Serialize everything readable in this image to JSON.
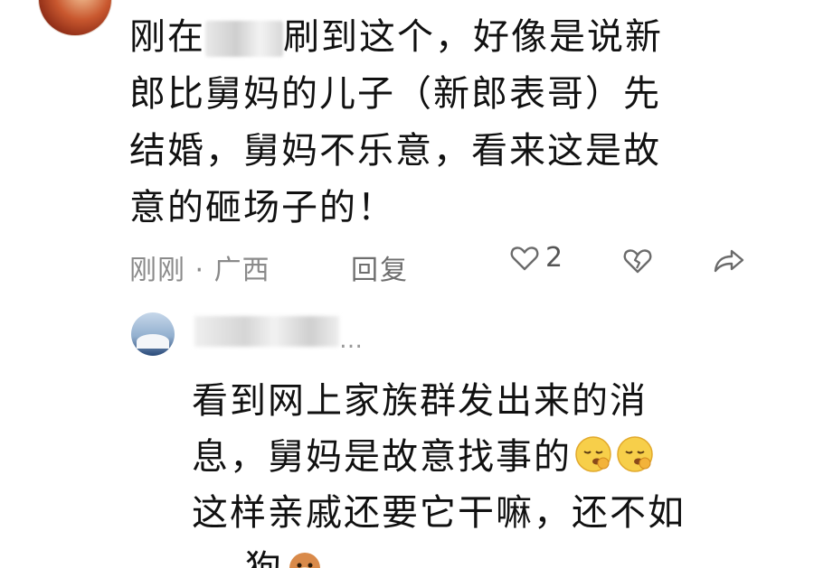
{
  "comment": {
    "line1_a": "刚在",
    "line1_b": "刷到这个，好像是说新",
    "line2": "郎比舅妈的儿子（新郎表哥）先",
    "line3": "结婚，舅妈不乐意，看来这是故",
    "line4": "意的砸场子的！",
    "time_location": "刚刚 · 广西",
    "reply_label": "回复",
    "like_count": "2",
    "icons": [
      "heart-outline-icon",
      "broken-heart-icon",
      "share-arrow-icon"
    ]
  },
  "reply": {
    "ellipsis": "…",
    "line1": "看到网上家族群发出来的消",
    "line2": "息，舅妈是故意找事的",
    "line3": "这样亲戚还要它干嘛，还不如",
    "line4_partial": "    狗",
    "emojis": [
      "pensive-face-emoji",
      "pensive-face-emoji",
      "dog-face-emoji"
    ]
  }
}
